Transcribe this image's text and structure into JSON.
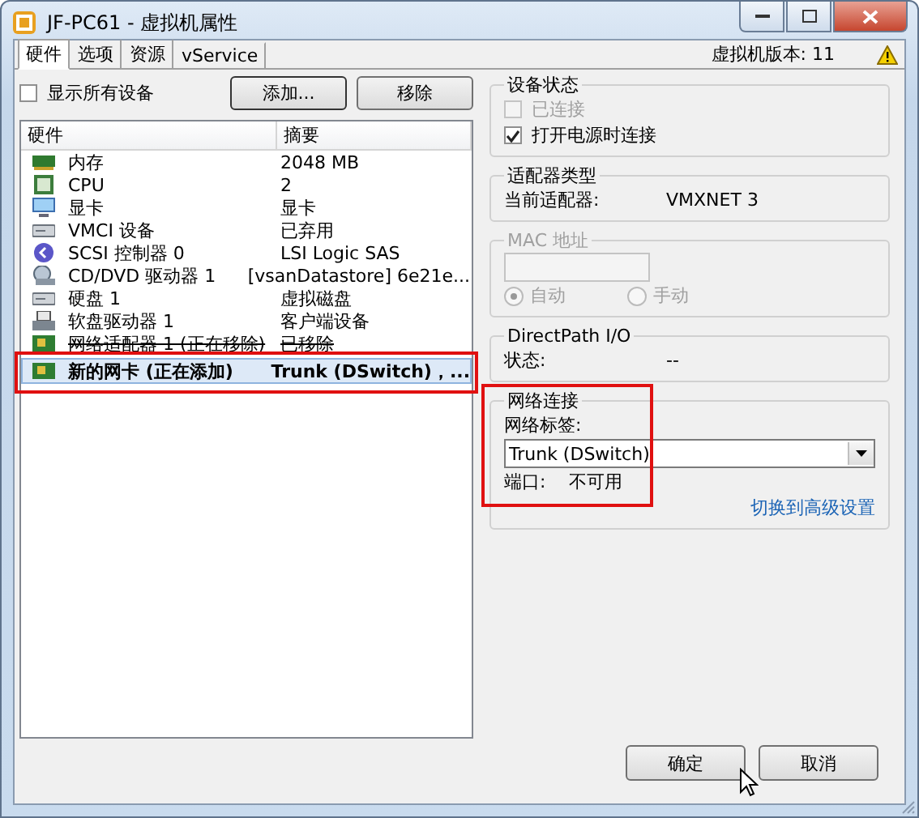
{
  "window": {
    "title": "JF-PC61 - 虚拟机属性"
  },
  "tabs": [
    {
      "label": "硬件",
      "selected": true
    },
    {
      "label": "选项",
      "selected": false
    },
    {
      "label": "资源",
      "selected": false
    },
    {
      "label": "vService",
      "selected": false
    }
  ],
  "version": "虚拟机版本: 11",
  "show_all_devices": {
    "label": "显示所有设备",
    "checked": false
  },
  "list_buttons": [
    "添加...",
    "移除"
  ],
  "hardware": {
    "columns": [
      "硬件",
      "摘要"
    ],
    "rows": [
      {
        "kind": "memory",
        "name": "内存",
        "summary": "2048 MB",
        "removed": false,
        "selected": false
      },
      {
        "kind": "cpu",
        "name": "CPU",
        "summary": "2",
        "removed": false,
        "selected": false
      },
      {
        "kind": "display",
        "name": "显卡",
        "summary": "显卡",
        "removed": false,
        "selected": false
      },
      {
        "kind": "vmci",
        "name": "VMCI 设备",
        "summary": "已弃用",
        "removed": false,
        "selected": false
      },
      {
        "kind": "scsi",
        "name": "SCSI 控制器 0",
        "summary": "LSI Logic SAS",
        "removed": false,
        "selected": false
      },
      {
        "kind": "cdrom",
        "name": "CD/DVD 驱动器 1",
        "summary": "[vsanDatastore] 6e21e...",
        "removed": false,
        "selected": false
      },
      {
        "kind": "disk",
        "name": "硬盘 1",
        "summary": "虚拟磁盘",
        "removed": false,
        "selected": false
      },
      {
        "kind": "floppy",
        "name": "软盘驱动器 1",
        "summary": "客户端设备",
        "removed": false,
        "selected": false
      },
      {
        "kind": "nic",
        "name": "网络适配器 1 (正在移除)",
        "summary": "已移除",
        "removed": true,
        "selected": false
      },
      {
        "kind": "nic",
        "name": "新的网卡 (正在添加)",
        "summary": "Trunk (DSwitch)，...",
        "removed": false,
        "selected": true
      }
    ]
  },
  "device_status": {
    "title": "设备状态",
    "items": [
      {
        "label": "已连接",
        "checked": false,
        "disabled": true
      },
      {
        "label": "打开电源时连接",
        "checked": true,
        "disabled": false
      }
    ]
  },
  "adapter_type": {
    "title": "适配器类型",
    "label": "当前适配器:",
    "value": "VMXNET 3"
  },
  "mac": {
    "title": "MAC 地址",
    "disabled": true,
    "options": [
      {
        "label": "自动",
        "selected": true
      },
      {
        "label": "手动",
        "selected": false
      }
    ]
  },
  "directpath": {
    "title": "DirectPath I/O",
    "label": "状态:",
    "value": "--"
  },
  "network": {
    "title": "网络连接",
    "label": "网络标签:",
    "value": "Trunk (DSwitch)",
    "port_label": "端口:",
    "port_value": "不可用",
    "link": "切换到高级设置"
  },
  "dialog_buttons": [
    "确定",
    "取消"
  ]
}
